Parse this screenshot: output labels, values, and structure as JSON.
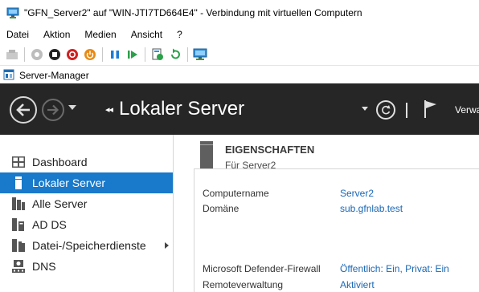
{
  "window": {
    "title": "\"GFN_Server2\" auf \"WIN-JTI7TD664E4\" - Verbindung mit virtuellen Computern"
  },
  "menu": {
    "items": [
      "Datei",
      "Aktion",
      "Medien",
      "Ansicht",
      "?"
    ]
  },
  "toolbar": {
    "buttons": [
      "ctrl-alt-del-icon",
      "start-icon",
      "stop-icon",
      "shutdown-icon",
      "power-icon",
      "pause-icon",
      "resume-icon",
      "checkpoint-icon",
      "revert-icon",
      "enhanced-session-icon"
    ]
  },
  "server_manager": {
    "caption": "Server-Manager"
  },
  "header": {
    "title": "Lokaler Server",
    "breadcrumb_prefix": "◂◂",
    "manage_label": "Verwa"
  },
  "sidebar": {
    "items": [
      {
        "label": "Dashboard",
        "icon": "dashboard-icon"
      },
      {
        "label": "Lokaler Server",
        "icon": "server-icon",
        "active": true
      },
      {
        "label": "Alle Server",
        "icon": "servers-icon"
      },
      {
        "label": "AD DS",
        "icon": "ad-ds-icon"
      },
      {
        "label": "Datei-/Speicherdienste",
        "icon": "file-storage-icon",
        "expandable": true
      },
      {
        "label": "DNS",
        "icon": "dns-icon"
      }
    ]
  },
  "properties": {
    "title": "EIGENSCHAFTEN",
    "subtitle": "Für Server2",
    "rows": [
      {
        "label": "Computername",
        "value": "Server2"
      },
      {
        "label": "Domäne",
        "value": "sub.gfnlab.test"
      },
      {
        "label": "Microsoft Defender-Firewall",
        "value": "Öffentlich: Ein, Privat: Ein"
      },
      {
        "label": "Remoteverwaltung",
        "value": "Aktiviert"
      }
    ]
  },
  "colors": {
    "header_bg": "#262626",
    "active_nav": "#1979ca",
    "link": "#1a67b4"
  }
}
